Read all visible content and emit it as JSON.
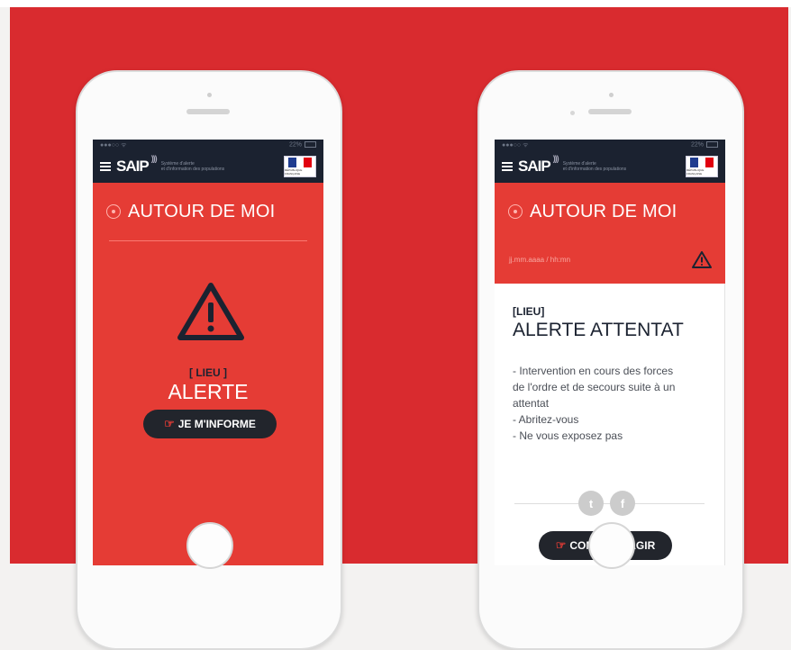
{
  "status_bar": {
    "carrier": "●●●○○ ᯤ",
    "battery": "22%"
  },
  "app": {
    "logo": "SAIP",
    "tagline_line1": "Système d'alerte",
    "tagline_line2": "et d'information des populations",
    "flag_caption": "RÉPUBLIQUE FRANÇAISE"
  },
  "left_screen": {
    "header_title": "AUTOUR DE MOI",
    "location": "[ LIEU ]",
    "alert": "ALERTE",
    "button_label": "JE M'INFORME"
  },
  "right_screen": {
    "header_title": "AUTOUR DE MOI",
    "datetime": "jj.mm.aaaa / hh:mn",
    "location": "[LIEU]",
    "alert_title": "ALERTE ATTENTAT",
    "description": [
      "- Intervention en cours des forces",
      "de l'ordre et de secours suite à un",
      "attentat",
      "- Abritez-vous",
      "- Ne vous exposez pas"
    ],
    "button_label": "COMMENT AGIR"
  },
  "icons": {
    "twitter": "t",
    "facebook": "f",
    "hand": "☞"
  },
  "colors": {
    "brand_red": "#e53c35",
    "navy": "#1b2230",
    "button_dark": "#22252c",
    "background_red": "#d92b2f"
  }
}
